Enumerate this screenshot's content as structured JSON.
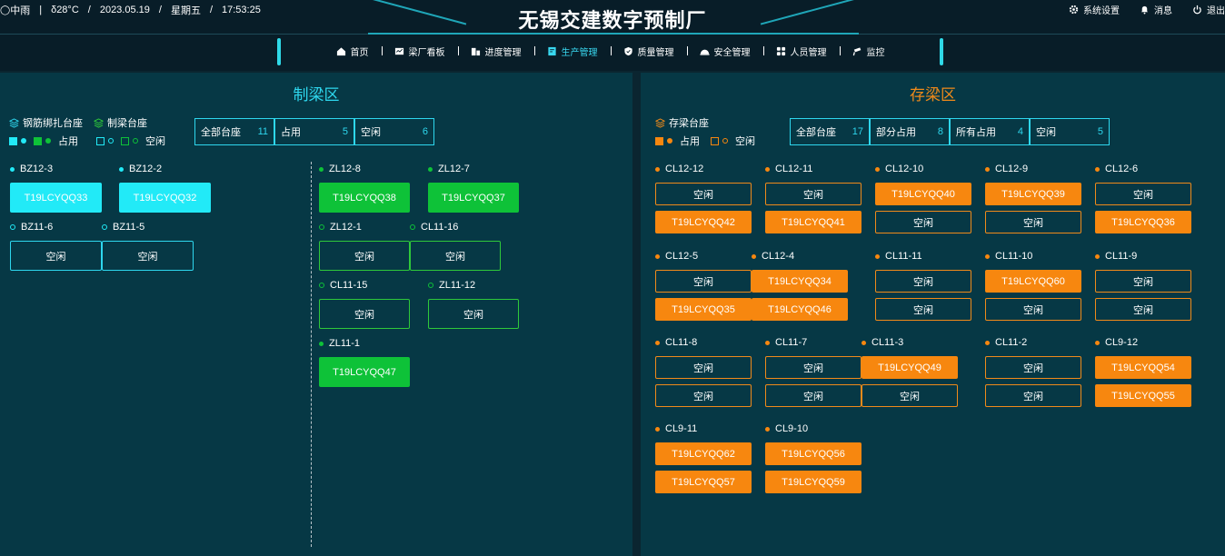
{
  "header": {
    "weather": "中雨",
    "temperature": "28°C",
    "date": "2023.05.19",
    "weekday": "星期五",
    "time": "17:53:25",
    "title": "无锡交建数字预制厂",
    "actions": [
      {
        "label": "系统设置",
        "icon": "gear-icon"
      },
      {
        "label": "消息",
        "icon": "bell-icon"
      },
      {
        "label": "退出",
        "icon": "power-icon"
      }
    ]
  },
  "nav": {
    "items": [
      {
        "label": "首页",
        "icon": "home-icon"
      },
      {
        "label": "梁厂看板",
        "icon": "dashboard-icon"
      },
      {
        "label": "进度管理",
        "icon": "building-icon"
      },
      {
        "label": "生产管理",
        "icon": "production-icon",
        "active": true
      },
      {
        "label": "质量管理",
        "icon": "shield-icon"
      },
      {
        "label": "安全管理",
        "icon": "helmet-icon"
      },
      {
        "label": "人员管理",
        "icon": "grid-icon"
      },
      {
        "label": "监控",
        "icon": "camera-icon"
      }
    ]
  },
  "left": {
    "title": "制梁区",
    "legend": {
      "type1": "钢筋绑扎台座",
      "type2": "制梁台座",
      "occupied": "占用",
      "free": "空闲"
    },
    "stats": [
      {
        "label": "全部台座",
        "value": "11"
      },
      {
        "label": "占用",
        "value": "5"
      },
      {
        "label": "空闲",
        "value": "6"
      }
    ],
    "groups": {
      "BZ12-3": {
        "name": "BZ12-3",
        "slot": "T19LCYQQ33"
      },
      "BZ12-2": {
        "name": "BZ12-2",
        "slot": "T19LCYQQ32"
      },
      "BZ11-6": {
        "name": "BZ11-6",
        "slot": "空闲"
      },
      "BZ11-5": {
        "name": "BZ11-5",
        "slot": "空闲"
      },
      "ZL12-8": {
        "name": "ZL12-8",
        "slot": "T19LCYQQ38"
      },
      "ZL12-7": {
        "name": "ZL12-7",
        "slot": "T19LCYQQ37"
      },
      "ZL12-1": {
        "name": "ZL12-1",
        "slot": "空闲"
      },
      "CL11-16": {
        "name": "CL11-16",
        "slot": "空闲"
      },
      "CL11-15": {
        "name": "CL11-15",
        "slot": "空闲"
      },
      "ZL11-12": {
        "name": "ZL11-12",
        "slot": "空闲"
      },
      "ZL11-1": {
        "name": "ZL11-1",
        "slot": "T19LCYQQ47"
      }
    }
  },
  "right": {
    "title": "存梁区",
    "legend": {
      "type": "存梁台座",
      "occupied": "占用",
      "free": "空闲"
    },
    "stats": [
      {
        "label": "全部台座",
        "value": "17"
      },
      {
        "label": "部分占用",
        "value": "8"
      },
      {
        "label": "所有占用",
        "value": "4"
      },
      {
        "label": "空闲",
        "value": "5"
      }
    ],
    "groups": [
      {
        "name": "CL12-12",
        "slots": [
          "空闲",
          "T19LCYQQ42"
        ]
      },
      {
        "name": "CL12-11",
        "slots": [
          "空闲",
          "T19LCYQQ41"
        ]
      },
      {
        "name": "CL12-10",
        "slots": [
          "T19LCYQQ40",
          "空闲"
        ]
      },
      {
        "name": "CL12-9",
        "slots": [
          "T19LCYQQ39",
          "空闲"
        ]
      },
      {
        "name": "CL12-6",
        "slots": [
          "空闲",
          "T19LCYQQ36"
        ]
      },
      {
        "name": "CL12-5",
        "slots": [
          "空闲",
          "T19LCYQQ35"
        ]
      },
      {
        "name": "CL12-4",
        "slots": [
          "T19LCYQQ34",
          "T19LCYQQ46"
        ]
      },
      {
        "name": "CL11-11",
        "slots": [
          "空闲",
          "空闲"
        ]
      },
      {
        "name": "CL11-10",
        "slots": [
          "T19LCYQQ60",
          "空闲"
        ]
      },
      {
        "name": "CL11-9",
        "slots": [
          "空闲",
          "空闲"
        ]
      },
      {
        "name": "CL11-8",
        "slots": [
          "空闲",
          "空闲"
        ]
      },
      {
        "name": "CL11-7",
        "slots": [
          "空闲",
          "空闲"
        ]
      },
      {
        "name": "CL11-3",
        "slots": [
          "T19LCYQQ49",
          "空闲"
        ]
      },
      {
        "name": "CL11-2",
        "slots": [
          "空闲",
          "空闲"
        ]
      },
      {
        "name": "CL9-12",
        "slots": [
          "T19LCYQQ54",
          "T19LCYQQ55"
        ]
      },
      {
        "name": "CL9-11",
        "slots": [
          "T19LCYQQ62",
          "T19LCYQQ57"
        ]
      },
      {
        "name": "CL9-10",
        "slots": [
          "T19LCYQQ56",
          "T19LCYQQ59"
        ]
      }
    ]
  },
  "colors": {
    "cyan": "#22eaf7",
    "green": "#0ec238",
    "orange": "#f7870f",
    "panel": "#063845",
    "bg": "#0b2530"
  }
}
